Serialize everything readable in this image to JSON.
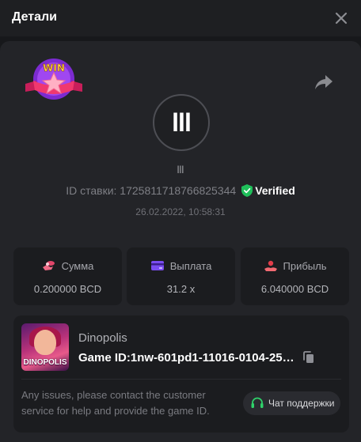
{
  "header": {
    "title": "Детали"
  },
  "badge": {
    "text": "WIN"
  },
  "bet": {
    "avatar_logo": "lll",
    "username": "lll",
    "id_label": "ID ставки:",
    "id_value": "1725811718766825344",
    "verified": "Verified",
    "datetime": "26.02.2022, 10:58:31"
  },
  "stats": [
    {
      "icon": "coins-icon",
      "label": "Сумма",
      "value": "0.200000 BCD"
    },
    {
      "icon": "card-icon",
      "label": "Выплата",
      "value": "31.2 x"
    },
    {
      "icon": "profit-icon",
      "label": "Прибыль",
      "value": "6.040000 BCD"
    }
  ],
  "game": {
    "thumb_text": "DINOPOLIS",
    "name": "Dinopolis",
    "id_text": "Game ID:1nw-601pd1-11016-0104-25121…",
    "help_text": "Any issues, please contact the customer service for help and provide the game ID.",
    "support_label": "Чат поддержки"
  },
  "colors": {
    "verified_green": "#1fbf5a",
    "coins_red": "#e2466a",
    "card_purple": "#7a4cf0",
    "profit_red": "#e23d4a",
    "support_green": "#2fd16a"
  }
}
